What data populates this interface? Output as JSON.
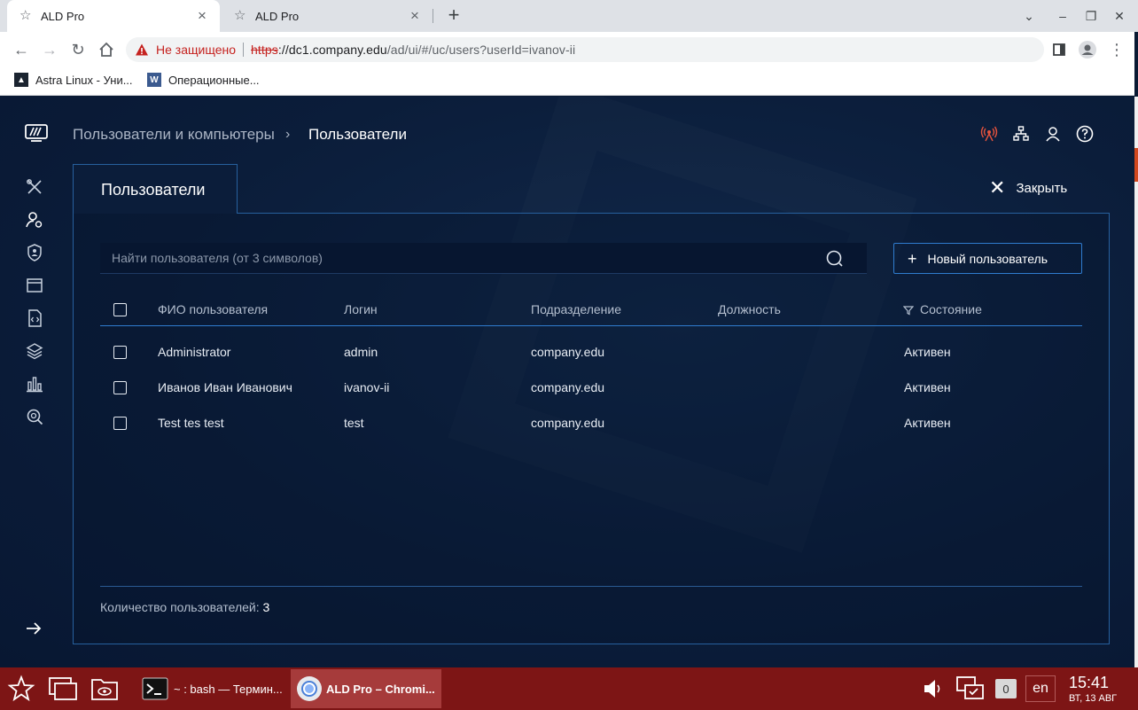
{
  "browser": {
    "tabs": [
      {
        "title": "ALD Pro",
        "active": true
      },
      {
        "title": "ALD Pro",
        "active": false
      }
    ],
    "security_label": "Не защищено",
    "url_protocol": "https",
    "url_host": "://dc1.company.edu",
    "url_path": "/ad/ui/#/uc/users?userId=ivanov-ii",
    "bookmarks": [
      {
        "label": "Astra Linux - Уни..."
      },
      {
        "label": "Операционные..."
      }
    ]
  },
  "app": {
    "breadcrumb": {
      "parent": "Пользователи и компьютеры",
      "separator": "›",
      "current": "Пользователи"
    },
    "panel_tab_label": "Пользователи",
    "close_label": "Закрыть",
    "search": {
      "placeholder": "Найти пользователя (от 3 символов)",
      "value": ""
    },
    "new_user_label": "Новый пользователь",
    "table": {
      "columns": [
        "ФИО пользователя",
        "Логин",
        "Подразделение",
        "Должность",
        "Состояние"
      ],
      "rows": [
        {
          "name": "Administrator",
          "login": "admin",
          "unit": "company.edu",
          "position": "",
          "state": "Активен"
        },
        {
          "name": "Иванов Иван Иванович",
          "login": "ivanov-ii",
          "unit": "company.edu",
          "position": "",
          "state": "Активен"
        },
        {
          "name": "Test tes test",
          "login": "test",
          "unit": "company.edu",
          "position": "",
          "state": "Активен"
        }
      ]
    },
    "count_label": "Количество пользователей:",
    "count_value": "3",
    "colors": {
      "accent": "#2f7ccf",
      "alert_icon": "#e5533d",
      "background": "#0b1d3a"
    }
  },
  "taskbar": {
    "tasks": [
      {
        "label": "~ : bash — Термин...",
        "active": false
      },
      {
        "label": "ALD Pro – Chromi...",
        "active": true
      }
    ],
    "notifications": "0",
    "keyboard_layout": "en",
    "time": "15:41",
    "date": "ВТ, 13 АВГ",
    "color": "#7d1515"
  }
}
